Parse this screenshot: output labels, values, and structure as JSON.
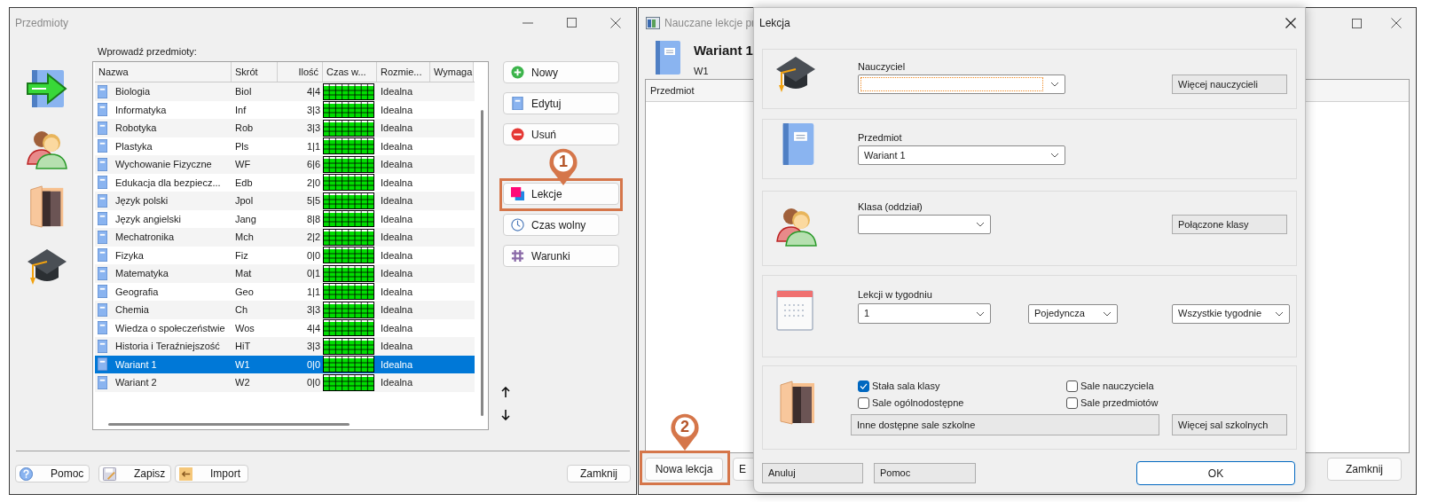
{
  "left_window": {
    "title": "Przedmioty",
    "list_label": "Wprowadź przedmioty:",
    "columns": [
      "Nazwa",
      "Skrót",
      "Ilość",
      "Czas w...",
      "Rozmie...",
      "Wymaga"
    ],
    "rows": [
      {
        "name": "Biologia",
        "abbr": "Biol",
        "count": "4|4",
        "size": "Idealna",
        "selected": false
      },
      {
        "name": "Informatyka",
        "abbr": "Inf",
        "count": "3|3",
        "size": "Idealna",
        "selected": false
      },
      {
        "name": "Robotyka",
        "abbr": "Rob",
        "count": "3|3",
        "size": "Idealna",
        "selected": false
      },
      {
        "name": "Plastyka",
        "abbr": "Pls",
        "count": "1|1",
        "size": "Idealna",
        "selected": false
      },
      {
        "name": "Wychowanie Fizyczne",
        "abbr": "WF",
        "count": "6|6",
        "size": "Idealna",
        "selected": false
      },
      {
        "name": "Edukacja dla bezpiecz...",
        "abbr": "Edb",
        "count": "2|0",
        "size": "Idealna",
        "selected": false
      },
      {
        "name": "Język polski",
        "abbr": "Jpol",
        "count": "5|5",
        "size": "Idealna",
        "selected": false
      },
      {
        "name": "Język angielski",
        "abbr": "Jang",
        "count": "8|8",
        "size": "Idealna",
        "selected": false
      },
      {
        "name": "Mechatronika",
        "abbr": "Mch",
        "count": "2|2",
        "size": "Idealna",
        "selected": false
      },
      {
        "name": "Fizyka",
        "abbr": "Fiz",
        "count": "0|0",
        "size": "Idealna",
        "selected": false
      },
      {
        "name": "Matematyka",
        "abbr": "Mat",
        "count": "0|1",
        "size": "Idealna",
        "selected": false
      },
      {
        "name": "Geografia",
        "abbr": "Geo",
        "count": "1|1",
        "size": "Idealna",
        "selected": false
      },
      {
        "name": "Chemia",
        "abbr": "Ch",
        "count": "3|3",
        "size": "Idealna",
        "selected": false
      },
      {
        "name": "Wiedza o społeczeństwie",
        "abbr": "Wos",
        "count": "4|4",
        "size": "Idealna",
        "selected": false
      },
      {
        "name": "Historia i Teraźniejszość",
        "abbr": "HiT",
        "count": "3|3",
        "size": "Idealna",
        "selected": false
      },
      {
        "name": "Wariant 1",
        "abbr": "W1",
        "count": "0|0",
        "size": "Idealna",
        "selected": true
      },
      {
        "name": "Wariant 2",
        "abbr": "W2",
        "count": "0|0",
        "size": "Idealna",
        "selected": false
      }
    ],
    "buttons": [
      {
        "label": "Nowy",
        "kind": "new"
      },
      {
        "label": "Edytuj",
        "kind": "edit"
      },
      {
        "label": "Usuń",
        "kind": "delete"
      },
      {
        "label": "Lekcje",
        "kind": "lessons"
      },
      {
        "label": "Czas wolny",
        "kind": "time"
      },
      {
        "label": "Warunki",
        "kind": "conditions"
      }
    ],
    "footer_buttons": [
      {
        "label": "Pomoc",
        "kind": "help"
      },
      {
        "label": "Zapisz",
        "kind": "save"
      },
      {
        "label": "Import",
        "kind": "import"
      }
    ],
    "close_button": "Zamknij"
  },
  "middle_window": {
    "title": "Nauczane lekcje pr",
    "subject": "Wariant 1",
    "abbr": "W1",
    "list_header": "Przedmiot",
    "buttons": [
      "Nowa lekcja",
      "E"
    ],
    "close_button": "Zamknij"
  },
  "dialog": {
    "title": "Lekcja",
    "teacher": {
      "label": "Nauczyciel",
      "focused": true,
      "more_button": "Więcej nauczycieli"
    },
    "subject": {
      "label": "Przedmiot",
      "value": "Wariant 1",
      "focused": false
    },
    "class": {
      "label": "Klasa (oddział)",
      "focused": false,
      "more_button": "Połączone klasy"
    },
    "lessons": {
      "label": "Lekcji w tygodniu",
      "value": "1",
      "type": "Pojedyncza",
      "weeks": "Wszystkie tygodnie"
    },
    "rooms": {
      "checkboxes": [
        {
          "label": "Stała sala klasy",
          "checked": true
        },
        {
          "label": "Sale ogólnodostępne",
          "checked": false
        },
        {
          "label": "Sale nauczyciela",
          "checked": false
        },
        {
          "label": "Sale przedmiotów",
          "checked": false
        }
      ],
      "other_rooms": "Inne dostępne sale szkolne",
      "more_button": "Więcej sal szkolnych"
    },
    "buttons": [
      {
        "label": "Anuluj",
        "default": false
      },
      {
        "label": "Pomoc",
        "default": false
      },
      {
        "label": "OK",
        "default": true
      }
    ]
  },
  "callouts": [
    {
      "label": "1"
    },
    {
      "label": "2"
    }
  ]
}
